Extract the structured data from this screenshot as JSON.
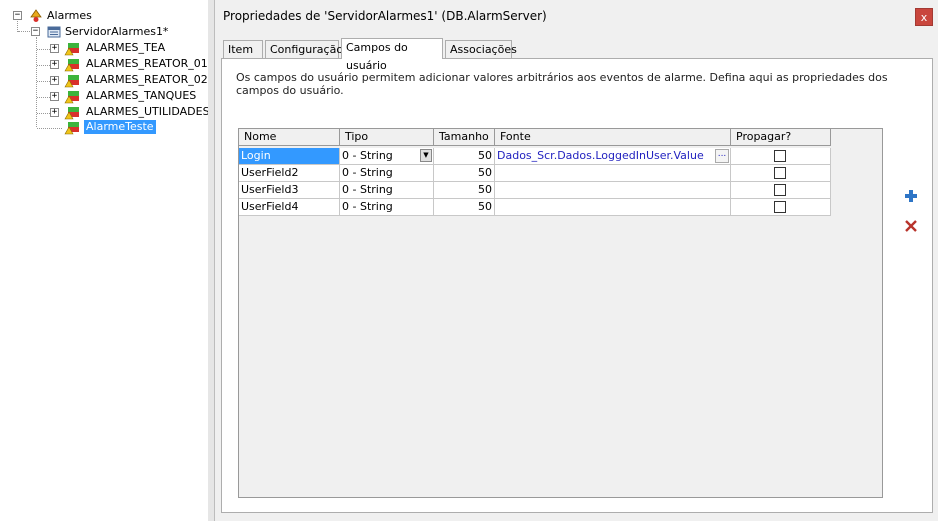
{
  "tree": {
    "root": "Alarmes",
    "server": "ServidorAlarmes1*",
    "groups": [
      "ALARMES_TEA",
      "ALARMES_REATOR_01",
      "ALARMES_REATOR_02",
      "ALARMES_TANQUES",
      "ALARMES_UTILIDADES"
    ],
    "selected": "AlarmeTeste",
    "expand_symbol": "+",
    "collapse_symbol": "−"
  },
  "dialog": {
    "title": "Propriedades de 'ServidorAlarmes1' (DB.AlarmServer)",
    "close_label": "x",
    "tabs": [
      {
        "label": "Item",
        "active": false
      },
      {
        "label": "Configuração",
        "active": false
      },
      {
        "label": "Campos do usuário",
        "active": true
      },
      {
        "label": "Associações",
        "active": false
      }
    ],
    "description": "Os campos do usuário permitem adicionar valores arbitrários aos eventos de alarme. Defina aqui as propriedades dos campos do usuário."
  },
  "grid": {
    "columns": [
      "Nome",
      "Tipo",
      "Tamanho",
      "Fonte",
      "Propagar?"
    ],
    "rows": [
      {
        "nome": "Login",
        "tipo": "0 - String",
        "tamanho": "50",
        "fonte": "Dados_Scr.Dados.LoggedInUser.Value",
        "propagar": false
      },
      {
        "nome": "UserField2",
        "tipo": "0 - String",
        "tamanho": "50",
        "fonte": "",
        "propagar": false
      },
      {
        "nome": "UserField3",
        "tipo": "0 - String",
        "tamanho": "50",
        "fonte": "",
        "propagar": false
      },
      {
        "nome": "UserField4",
        "tipo": "0 - String",
        "tamanho": "50",
        "fonte": "",
        "propagar": false
      }
    ],
    "ellipsis": "...",
    "dropdown_arrow": "▼"
  },
  "actions": {
    "add_icon": "plus-icon",
    "delete_icon": "delete-x-icon",
    "add_color": "#2e75c6",
    "delete_color": "#b8332b"
  },
  "colors": {
    "selection": "#3399ff",
    "fonte_text": "#1f1fbf",
    "close_bg": "#c9463d"
  }
}
